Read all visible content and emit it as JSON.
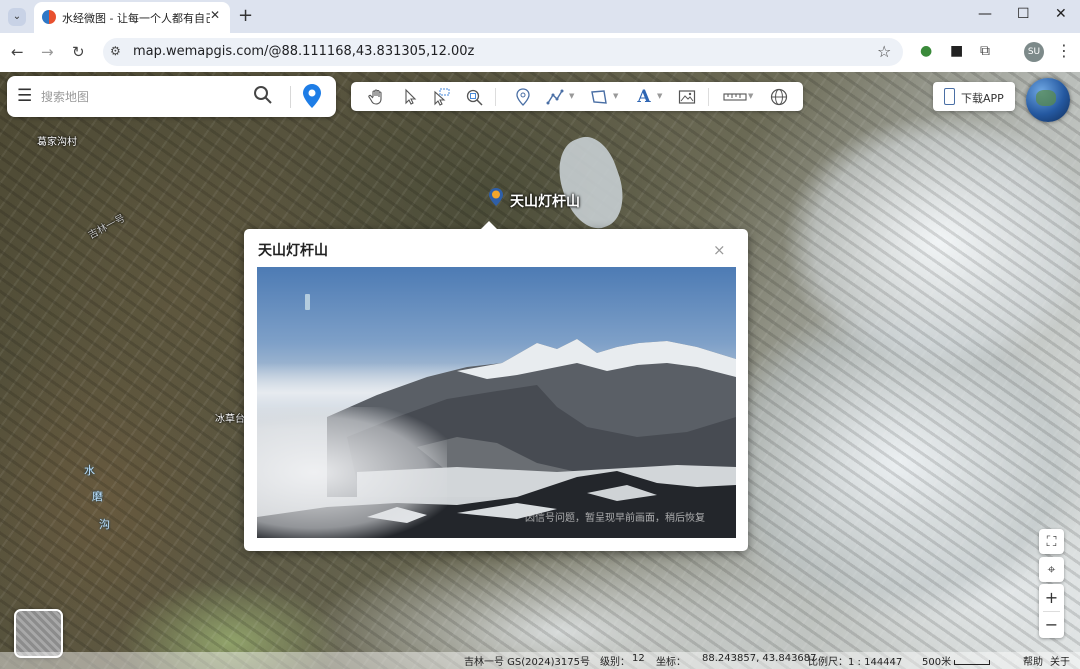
{
  "browser": {
    "tab_title": "水经微图 - 让每一个人都有自己",
    "url": "map.wemapgis.com/@88.111168,43.831305,12.00z",
    "profile_initials": "SU"
  },
  "search": {
    "placeholder": "搜索地图"
  },
  "toolbar": {
    "tools": [
      "pan-tool",
      "select-tool",
      "box-select-tool",
      "zoom-tool",
      "marker-tool",
      "line-tool",
      "polygon-tool",
      "text-tool",
      "image-tool",
      "measure-tool",
      "globe-tool"
    ]
  },
  "download": {
    "label": "下载APP"
  },
  "map": {
    "places": {
      "village": "葛家沟村",
      "road": "吉林一号",
      "ice": "冰草台",
      "water1": "水",
      "water2": "磨",
      "water3": "沟"
    },
    "peak_label": "天山灯杆山"
  },
  "popup": {
    "title": "天山灯杆山",
    "close": "×",
    "photo_notice": "因信号问题，暂呈现早前画面，稍后恢复"
  },
  "controls": {
    "zoom_in": "+",
    "zoom_out": "−"
  },
  "status": {
    "copyright": "吉林一号 GS(2024)3175号",
    "level_label": "级别：",
    "level_value": "12",
    "coord_label": "坐标：",
    "coords": "88.243857, 43.843687",
    "scale_label": "比例尺：1 : 144447",
    "scale_dist": "500米",
    "help": "帮助",
    "about": "关于"
  }
}
